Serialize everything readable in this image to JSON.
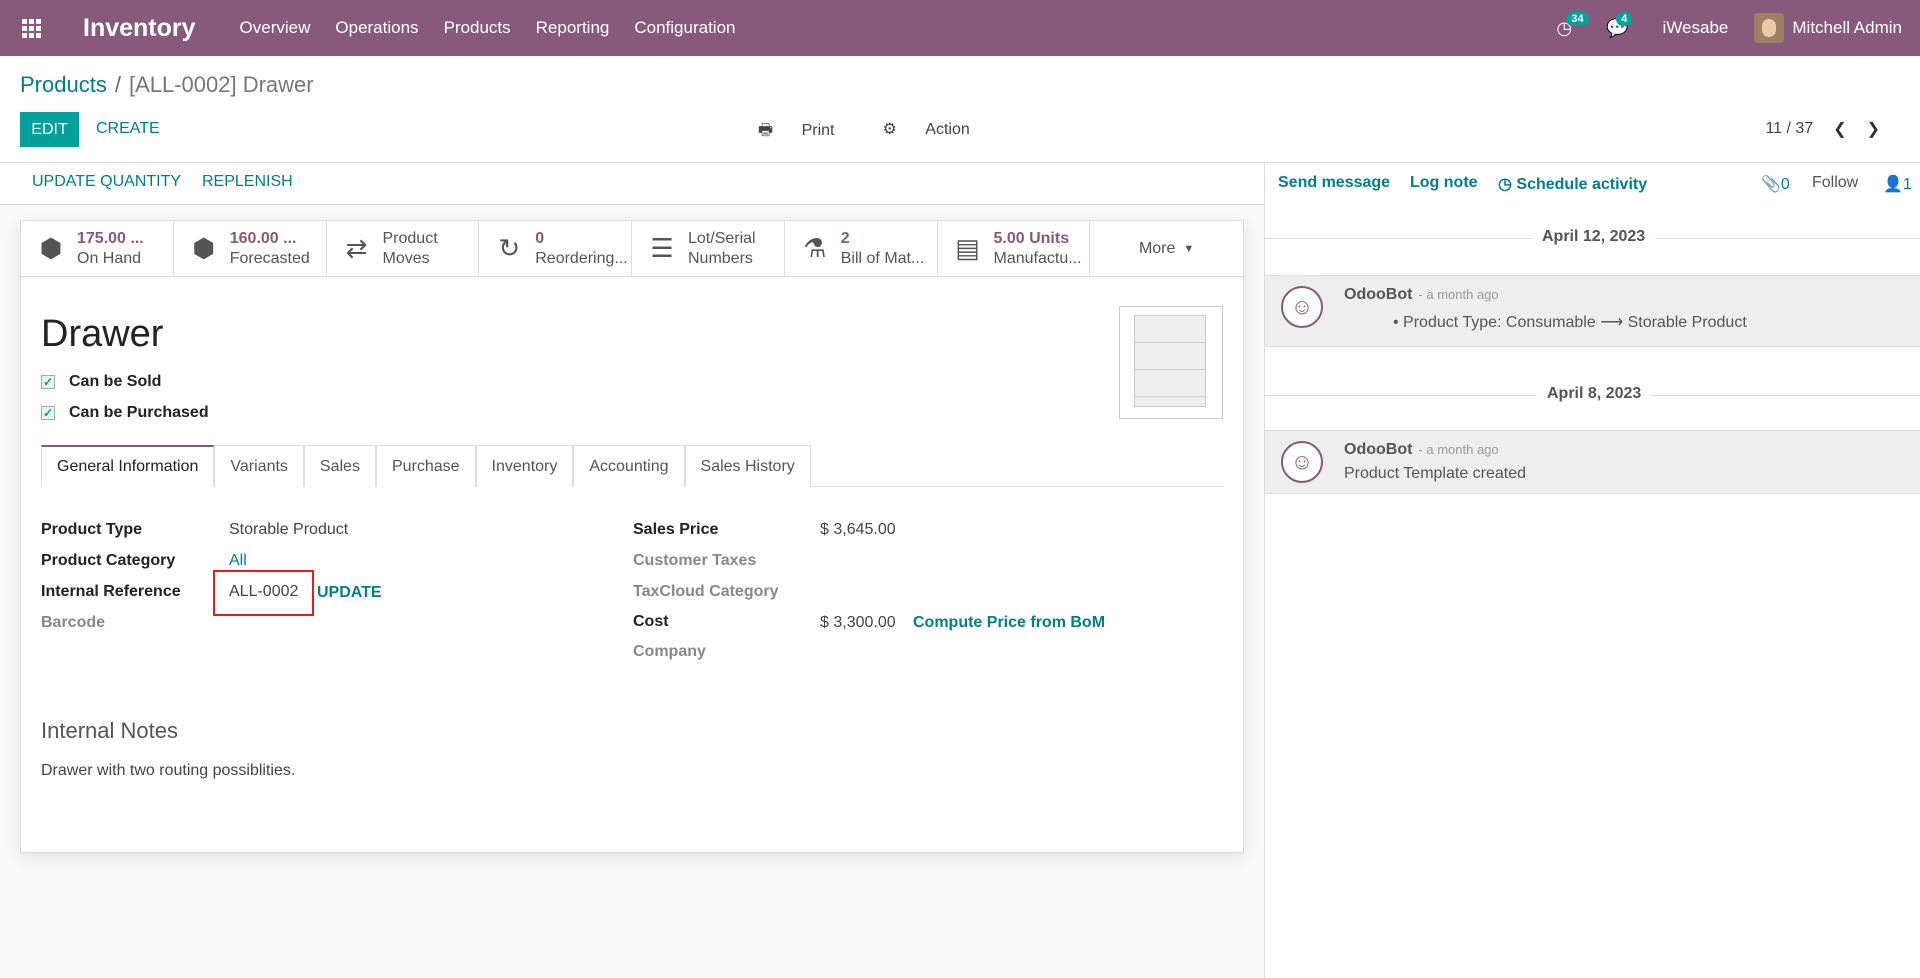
{
  "topbar": {
    "app_name": "Inventory",
    "menu": [
      "Overview",
      "Operations",
      "Products",
      "Reporting",
      "Configuration"
    ],
    "activity_count": "34",
    "message_count": "4",
    "company": "iWesabe",
    "user": "Mitchell Admin"
  },
  "breadcrumb": {
    "parent": "Products",
    "separator": "/",
    "current": "[ALL-0002] Drawer"
  },
  "toolbar": {
    "edit": "EDIT",
    "create": "CREATE",
    "print": "Print",
    "action": "Action",
    "pager": "11 / 37"
  },
  "header_buttons": {
    "update_qty": "UPDATE QUANTITY",
    "replenish": "REPLENISH"
  },
  "smart_buttons": [
    {
      "icon": "cubes-icon",
      "value": "175.00 ...",
      "label": "On Hand"
    },
    {
      "icon": "cubes-icon",
      "value": "160.00 ...",
      "label": "Forecasted"
    },
    {
      "icon": "exchange-icon",
      "value": "Product",
      "label": "Moves"
    },
    {
      "icon": "refresh-icon",
      "value": "0",
      "label": "Reordering..."
    },
    {
      "icon": "bars-icon",
      "value": "Lot/Serial",
      "label": "Numbers"
    },
    {
      "icon": "flask-icon",
      "value": "2",
      "label": "Bill of Mat..."
    },
    {
      "icon": "list-icon",
      "value": "5.00 Units",
      "label": "Manufactu..."
    }
  ],
  "more_label": "More",
  "product": {
    "name": "Drawer",
    "can_be_sold": "Can be Sold",
    "can_be_purchased": "Can be Purchased"
  },
  "tabs": [
    "General Information",
    "Variants",
    "Sales",
    "Purchase",
    "Inventory",
    "Accounting",
    "Sales History"
  ],
  "fields": {
    "product_type_label": "Product Type",
    "product_type": "Storable Product",
    "category_label": "Product Category",
    "category": "All",
    "internal_ref_label": "Internal Reference",
    "internal_ref": "ALL-0002",
    "update": "UPDATE",
    "barcode_label": "Barcode",
    "sales_price_label": "Sales Price",
    "sales_price": "$ 3,645.00",
    "customer_taxes_label": "Customer Taxes",
    "taxcloud_label": "TaxCloud Category",
    "cost_label": "Cost",
    "cost": "$ 3,300.00",
    "compute": "Compute Price from BoM",
    "company_label": "Company"
  },
  "notes": {
    "heading": "Internal Notes",
    "text": "Drawer with two routing possiblities."
  },
  "chatter": {
    "send": "Send message",
    "log": "Log note",
    "schedule": "Schedule activity",
    "attachments": "0",
    "follow": "Follow",
    "followers": "1",
    "date1": "April 12, 2023",
    "author1": "OdooBot",
    "time1": "- a month ago",
    "body1": "Product Type: Consumable ⟶ Storable Product",
    "date2": "April 8, 2023",
    "author2": "OdooBot",
    "time2": "- a month ago",
    "body2": "Product Template created"
  }
}
